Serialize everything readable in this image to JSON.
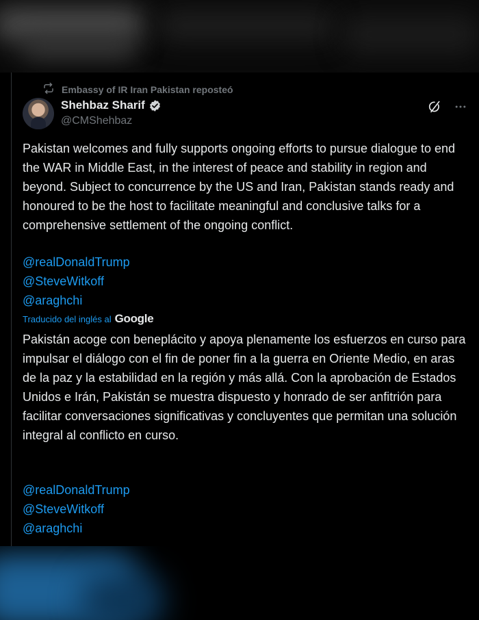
{
  "repost": {
    "text": "Embassy of IR Iran Pakistan reposteó",
    "icon": "repost-icon"
  },
  "author": {
    "name": "Shehbaz Sharif",
    "handle": "@CMShehbaz",
    "verified": true
  },
  "post": {
    "original_text": "Pakistan welcomes and fully supports ongoing efforts to pursue dialogue to end the WAR in Middle East, in the interest of peace and stability in region and beyond. Subject to concurrence by the US and Iran, Pakistan stands ready and honoured to be the host to facilitate meaningful and conclusive talks for a comprehensive settlement of the ongoing conflict.",
    "mentions": [
      "@realDonaldTrump",
      "@SteveWitkoff",
      "@araghchi"
    ],
    "translated_label": "Traducido del inglés al",
    "translator": "Google",
    "translated_text": "Pakistán acoge con beneplácito y apoya plenamente los esfuerzos en curso para impulsar el diálogo con el fin de poner fin a la guerra en Oriente Medio, en aras de la paz y la estabilidad en la región y más allá. Con la aprobación de Estados Unidos e Irán, Pakistán se muestra dispuesto y honrado de ser anfitrión para facilitar conversaciones significativas y concluyentes que permitan una solución integral al conflicto en curso.",
    "translated_mentions": [
      "@realDonaldTrump",
      "@SteveWitkoff",
      "@araghchi"
    ]
  },
  "colors": {
    "background": "#000000",
    "text": "#e7e9ea",
    "muted": "#71767b",
    "link": "#1d9bf0",
    "border": "#2f3336"
  }
}
